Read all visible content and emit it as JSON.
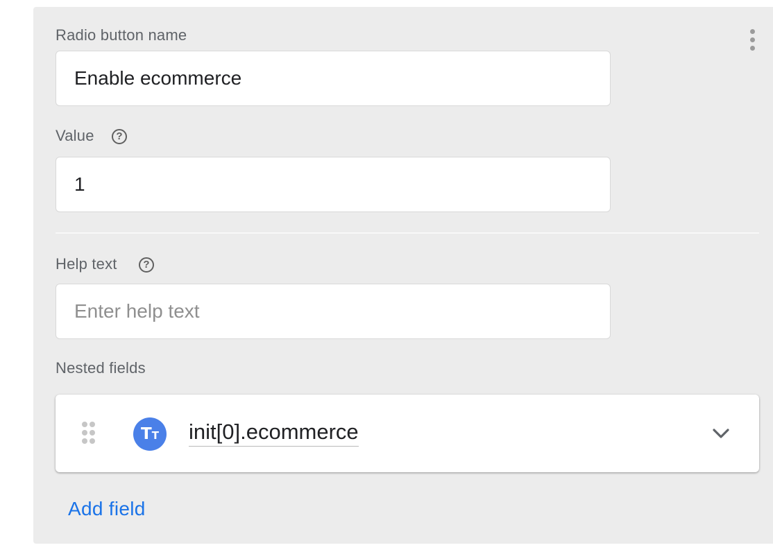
{
  "radio_name": {
    "label": "Radio button name",
    "value": "Enable ecommerce"
  },
  "value_field": {
    "label": "Value",
    "value": "1",
    "help_icon": "help-circle-icon"
  },
  "help_text": {
    "label": "Help text",
    "value": "",
    "placeholder": "Enter help text",
    "help_icon": "help-circle-icon"
  },
  "nested_fields": {
    "label": "Nested fields",
    "items": [
      {
        "name": "init[0].ecommerce",
        "type_icon": "text-type-icon",
        "icon_color": "#4a80e8"
      }
    ]
  },
  "add_field_label": "Add field",
  "accent_color": "#1a73e8",
  "more_menu_icon": "more-vert-icon"
}
